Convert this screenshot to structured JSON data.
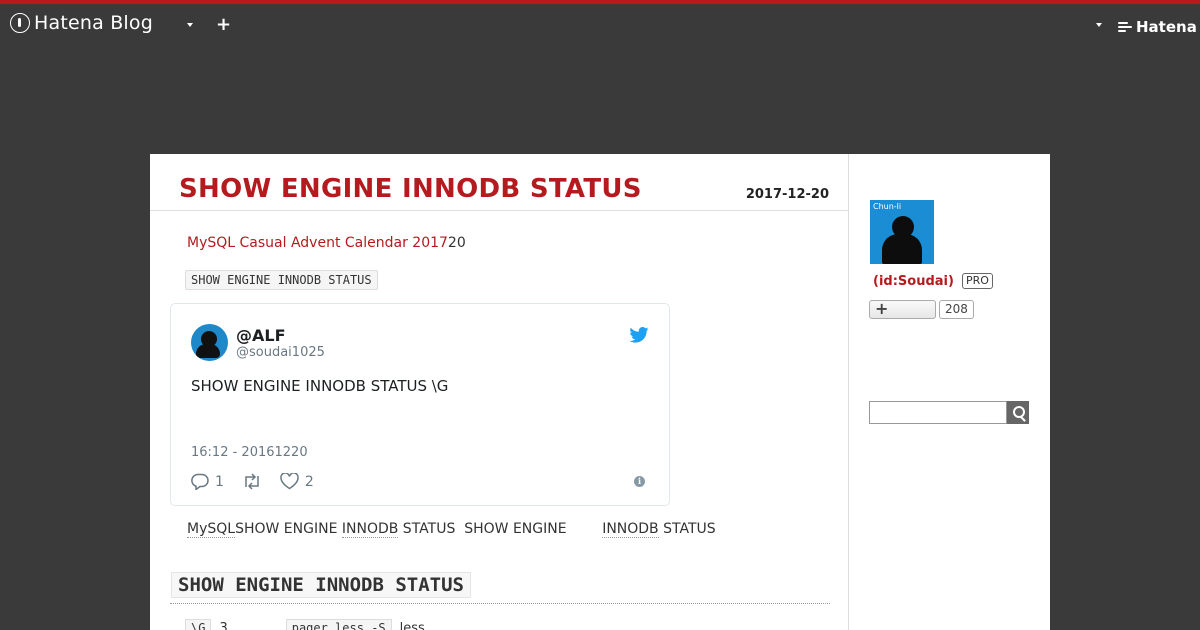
{
  "topbar": {
    "logo": "Hatena Blog",
    "add_symbol": "+",
    "brand": "Hatena"
  },
  "entry": {
    "title": "SHOW ENGINE INNODB STATUS",
    "date": "2017-12-20",
    "advent_link": "MySQL Casual Advent Calendar 2017",
    "advent_suffix": "20",
    "code_tag": "SHOW ENGINE INNODB STATUS",
    "paragraph": {
      "part1": "MySQL",
      "part2": "SHOW ENGINE ",
      "part3": "INNODB",
      "part4": " STATUS  SHOW ENGINE        ",
      "part5": "INNODB",
      "part6": " STATUS"
    },
    "heading": "SHOW ENGINE INNODB STATUS",
    "bottom": {
      "code1": "\\G",
      "num": "3",
      "code2": "pager less -S",
      "word": "less"
    }
  },
  "tweet": {
    "name": "@ALF",
    "handle": "@soudai1025",
    "text": "SHOW ENGINE INNODB STATUS \\G",
    "time": "16:12 - 20161220",
    "replies": "1",
    "likes": "2",
    "info": "i"
  },
  "sidebar": {
    "avatar_label": "Chun-li",
    "user_id": "(id:Soudai)",
    "pro": "PRO",
    "follow_plus": "+",
    "follower_count": "208",
    "search_value": ""
  },
  "colors": {
    "accent": "#b51a1e",
    "background": "#3a3a3a",
    "twitter_blue": "#1da1f2"
  }
}
